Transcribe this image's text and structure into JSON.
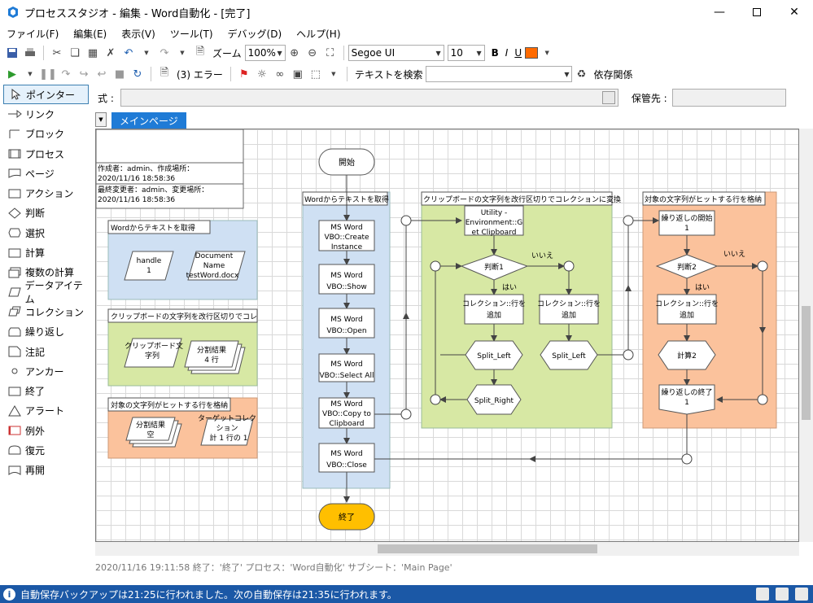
{
  "window": {
    "title": "プロセススタジオ - 編集 - Word自動化 - [完了]"
  },
  "menu": [
    "ファイル(F)",
    "編集(E)",
    "表示(V)",
    "ツール(T)",
    "デバッグ(D)",
    "ヘルプ(H)"
  ],
  "toolbar": {
    "zoom_label": "ズーム",
    "zoom_value": "100%",
    "font_name": "Segoe UI",
    "font_size": "10",
    "bold": "B",
    "italic": "I",
    "underline": "U",
    "fill_color": "#ff6a00",
    "errors": "(3) エラー",
    "search_label": "テキストを検索",
    "dependencies": "依存関係"
  },
  "formula": {
    "label": "式 :",
    "store_label": "保管先 :"
  },
  "palette": [
    {
      "label": "ポインター",
      "icon": "pointer-icon",
      "selected": true
    },
    {
      "label": "リンク",
      "icon": "link-icon"
    },
    {
      "label": "ブロック",
      "icon": "block-icon"
    },
    {
      "label": "プロセス",
      "icon": "process-icon"
    },
    {
      "label": "ページ",
      "icon": "page-icon"
    },
    {
      "label": "アクション",
      "icon": "action-icon"
    },
    {
      "label": "判断",
      "icon": "decision-icon"
    },
    {
      "label": "選択",
      "icon": "choice-icon"
    },
    {
      "label": "計算",
      "icon": "calculation-icon"
    },
    {
      "label": "複数の計算",
      "icon": "multi-calc-icon"
    },
    {
      "label": "データアイテム",
      "icon": "data-item-icon"
    },
    {
      "label": "コレクション",
      "icon": "collection-icon"
    },
    {
      "label": "繰り返し",
      "icon": "loop-icon"
    },
    {
      "label": "注記",
      "icon": "note-icon"
    },
    {
      "label": "アンカー",
      "icon": "anchor-icon"
    },
    {
      "label": "終了",
      "icon": "end-icon"
    },
    {
      "label": "アラート",
      "icon": "alert-icon"
    },
    {
      "label": "例外",
      "icon": "exception-icon"
    },
    {
      "label": "復元",
      "icon": "recover-icon"
    },
    {
      "label": "再開",
      "icon": "resume-icon"
    }
  ],
  "tab": "メインページ",
  "info_box": {
    "created": "作成者：admin、作成場所：",
    "created_date": "2020/11/16 18:58:36",
    "modified": "最終変更者：admin、変更場所：",
    "modified_date": "2020/11/16 18:58:36"
  },
  "blocks": {
    "b1": {
      "title": "Wordからテキストを取得",
      "item1": [
        "handle",
        "1"
      ],
      "item2": [
        "Document",
        "Name",
        "testWord.docx"
      ]
    },
    "b2": {
      "title": "クリップボードの文字列を改行区切りでコレ",
      "item1": [
        "クリップボード文",
        "字列"
      ],
      "item2": [
        "分割結果",
        "4 行"
      ]
    },
    "b3": {
      "title": "対象の文字列がヒットする行を格納",
      "item1": [
        "分割結果",
        "空"
      ],
      "item2": [
        "ターゲットコレク",
        "ション",
        "計 1 行の 1"
      ]
    },
    "main": {
      "title": "Wordからテキストを取得"
    },
    "clip": {
      "title": "クリップボードの文字列を改行区切りでコレクションに変換"
    },
    "target": {
      "title": "対象の文字列がヒットする行を格納"
    }
  },
  "flow": {
    "start": "開始",
    "end": "終了",
    "actions": [
      [
        "MS Word",
        "VBO::Create",
        "Instance"
      ],
      [
        "MS Word",
        "VBO::Show"
      ],
      [
        "MS Word",
        "VBO::Open"
      ],
      [
        "MS Word",
        "VBO::Select All"
      ],
      [
        "MS Word",
        "VBO::Copy to",
        "Clipboard"
      ],
      [
        "MS Word",
        "VBO::Close"
      ]
    ],
    "clip_action": [
      "Utility -",
      "Environment::G",
      "et Clipboard"
    ],
    "decision1": "判断1",
    "yes": "はい",
    "no": "いいえ",
    "add_row": [
      "コレクション::行を",
      "追加"
    ],
    "split_left": "Split_Left",
    "split_right": "Split_Right",
    "loop_start": [
      "繰り返しの開始",
      "1"
    ],
    "decision2": "判断2",
    "calc2": "計算2",
    "loop_end": [
      "繰り返しの終了",
      "1"
    ]
  },
  "info_line": "2020/11/16 19:11:58 終了：'終了' プロセス：'Word自動化' サブシート：'Main Page'",
  "status": "自動保存バックアップは21:25に行われました。次の自動保存は21:35に行われます。"
}
